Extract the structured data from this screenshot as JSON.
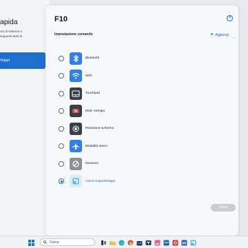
{
  "left_panel": {
    "heading": "apida",
    "desc_lines": [
      "oni di sistema o",
      "seguenti tasti di"
    ],
    "button_label": "Vidget"
  },
  "dialog": {
    "title": "F10",
    "help_glyph": "?",
    "subtitle": "Impostazione comando",
    "add_label": "Aggiungi",
    "save_label": "Salva",
    "options": [
      {
        "label": "Bluetooth",
        "icon": "bluetooth-icon",
        "selected": false
      },
      {
        "label": "WiFi",
        "icon": "wifi-icon",
        "selected": false
      },
      {
        "label": "Touchpad",
        "icon": "touchpad-icon",
        "selected": false
      },
      {
        "label": "Mod. energia",
        "icon": "power-mode-icon",
        "selected": false
      },
      {
        "label": "Rotazione schermo",
        "icon": "rotate-screen-icon",
        "selected": false
      },
      {
        "label": "Modalità aereo",
        "icon": "airplane-icon",
        "selected": false
      },
      {
        "label": "Nessuno",
        "icon": "none-icon",
        "selected": false
      },
      {
        "label": "ASUS ExpertWidget",
        "icon": "expertwidget-icon",
        "selected": true
      }
    ]
  },
  "taskbar": {
    "search_placeholder": "Cerca",
    "pinned": [
      "start-icon",
      "search-icon",
      "task-view-icon",
      "file-explorer-icon",
      "edge-icon",
      "chrome-icon",
      "store-icon",
      "teams-icon",
      "photos-icon",
      "mail-icon",
      "word-icon",
      "settings-icon"
    ]
  },
  "colors": {
    "accent": "#1a66c2",
    "button_blue": "#1f6fd0",
    "icon_blue": "#2f80ed"
  }
}
